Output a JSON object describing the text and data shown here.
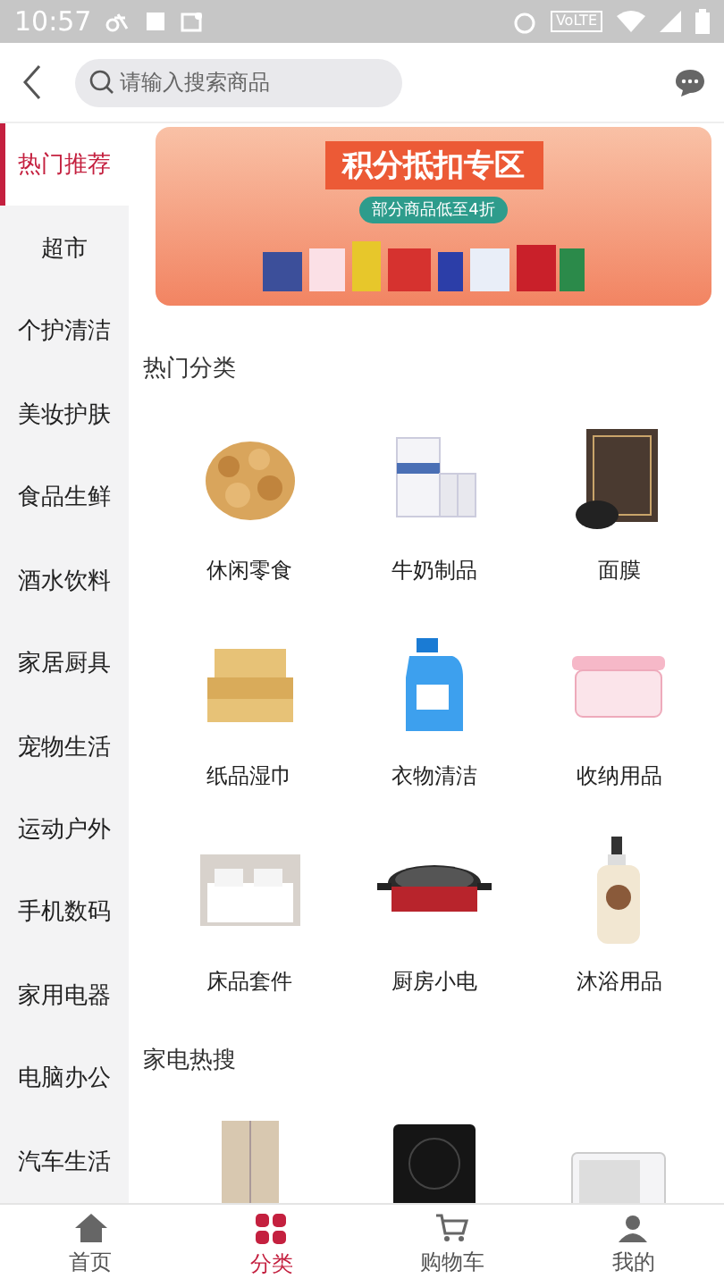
{
  "status_bar": {
    "time": "10:57",
    "network_badge": "VoLTE"
  },
  "header": {
    "search": {
      "placeholder": "请输入搜索商品"
    }
  },
  "sidebar": {
    "items": [
      {
        "label": "热门推荐",
        "selected": true
      },
      {
        "label": "超市",
        "selected": false
      },
      {
        "label": "个护清洁",
        "selected": false
      },
      {
        "label": "美妆护肤",
        "selected": false
      },
      {
        "label": "食品生鲜",
        "selected": false
      },
      {
        "label": "酒水饮料",
        "selected": false
      },
      {
        "label": "家居厨具",
        "selected": false
      },
      {
        "label": "宠物生活",
        "selected": false
      },
      {
        "label": "运动户外",
        "selected": false
      },
      {
        "label": "手机数码",
        "selected": false
      },
      {
        "label": "家用电器",
        "selected": false
      },
      {
        "label": "电脑办公",
        "selected": false
      },
      {
        "label": "汽车生活",
        "selected": false
      }
    ]
  },
  "banner": {
    "title": "积分抵扣专区",
    "subtitle": "部分商品低至4折"
  },
  "sections": [
    {
      "title": "热门分类",
      "items": [
        {
          "label": "休闲零食",
          "kind": "snack"
        },
        {
          "label": "牛奶制品",
          "kind": "milk"
        },
        {
          "label": "面膜",
          "kind": "mask"
        },
        {
          "label": "纸品湿巾",
          "kind": "tissue"
        },
        {
          "label": "衣物清洁",
          "kind": "detergent"
        },
        {
          "label": "收纳用品",
          "kind": "storage"
        },
        {
          "label": "床品套件",
          "kind": "bed"
        },
        {
          "label": "厨房小电",
          "kind": "cooker"
        },
        {
          "label": "沐浴用品",
          "kind": "bottle"
        }
      ]
    },
    {
      "title": "家电热搜",
      "items": [
        {
          "kind": "fridge"
        },
        {
          "kind": "induction"
        },
        {
          "kind": "microwave"
        }
      ]
    }
  ],
  "bottom_nav": [
    {
      "label": "首页",
      "kind": "home",
      "selected": false
    },
    {
      "label": "分类",
      "kind": "category",
      "selected": true
    },
    {
      "label": "购物车",
      "kind": "cart",
      "selected": false
    },
    {
      "label": "我的",
      "kind": "profile",
      "selected": false
    }
  ]
}
